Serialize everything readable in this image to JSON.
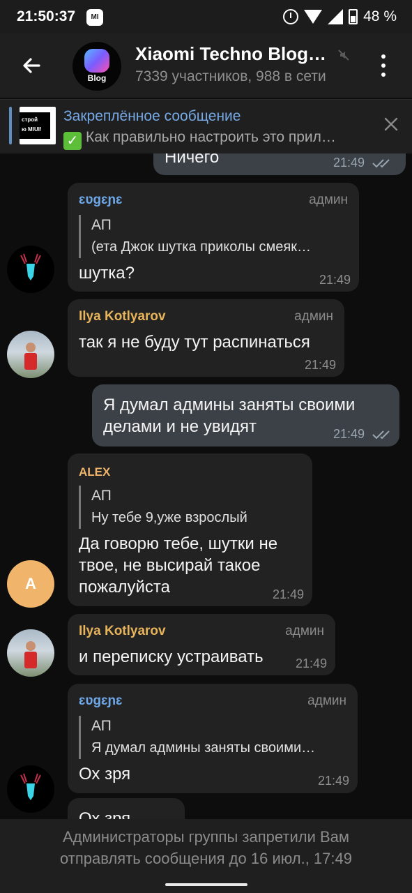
{
  "status_bar": {
    "time": "21:50:37",
    "mi_badge": "MI",
    "battery_percent": "48 %"
  },
  "header": {
    "avatar_label": "Blog",
    "title": "Xiaomi Techno Blog…",
    "subtitle": "7339 участников, 988 в сети"
  },
  "pinned": {
    "title": "Закреплённое сообщение",
    "text": "Как правильно настроить это прил…",
    "thumb_line1": "строй",
    "thumb_line2": "ю MIUI!"
  },
  "messages": [
    {
      "id": "m0",
      "direction": "out",
      "text": "Ничего",
      "time": "21:49",
      "read": true
    },
    {
      "id": "m1",
      "direction": "in",
      "sender": "ɛʋɡɛɲɛ",
      "sender_color": "#6ea8e8",
      "role": "админ",
      "reply_to": {
        "name": "АП",
        "text": "(ета Джок шутка приколы смеяк…"
      },
      "text": "шутка?",
      "time": "21:49"
    },
    {
      "id": "m2",
      "direction": "in",
      "sender": "Ilya Kotlyarov",
      "sender_color": "#e8b45a",
      "role": "админ",
      "text": "так я не буду тут распинаться",
      "time": "21:49"
    },
    {
      "id": "m3",
      "direction": "out",
      "text": "Я думал админы заняты своими\nделами и не увидят",
      "time": "21:49",
      "read": true
    },
    {
      "id": "m4",
      "direction": "in",
      "sender": "ALEX",
      "sender_color": "#f0b46a",
      "role": "",
      "avatar_initial": "A",
      "reply_to": {
        "name": "АП",
        "text": "Ну тебе 9,уже взрослый"
      },
      "text": "Да говорю тебе, шутки не\nтвое, не высирай такое\nпожалуйста",
      "time": "21:49"
    },
    {
      "id": "m5",
      "direction": "in",
      "sender": "Ilya Kotlyarov",
      "sender_color": "#e8b45a",
      "role": "админ",
      "text": "и переписку устраивать",
      "time": "21:49"
    },
    {
      "id": "m6",
      "direction": "in",
      "sender": "ɛʋɡɛɲɛ",
      "sender_color": "#6ea8e8",
      "role": "админ",
      "reply_to": {
        "name": "АП",
        "text": "Я думал админы заняты своими…"
      },
      "text": "Ох зря",
      "time": "21:49"
    },
    {
      "id": "m7",
      "direction": "in",
      "text": "Ох зря"
    }
  ],
  "bottom": {
    "notice": "Администраторы группы запретили Вам отправлять сообщения до 16 июл., 17:49"
  },
  "colors": {
    "background": "#0d0d0d",
    "incoming_bubble": "#222222",
    "outgoing_bubble": "#3b4147",
    "link_blue": "#75a9e6"
  }
}
